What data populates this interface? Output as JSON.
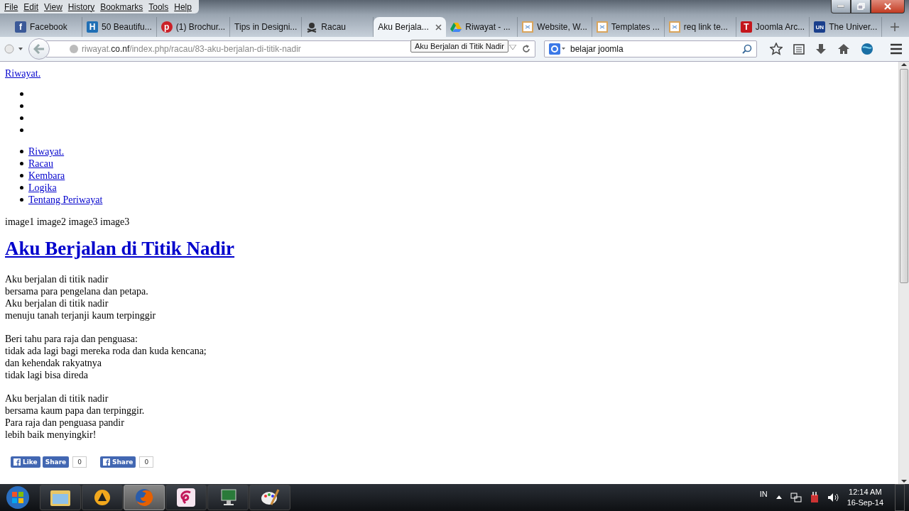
{
  "menu_bar": [
    "File",
    "Edit",
    "View",
    "History",
    "Bookmarks",
    "Tools",
    "Help"
  ],
  "tabs": [
    {
      "label": "Facebook",
      "selected": false,
      "favicon": {
        "kind": "letter",
        "text": "f",
        "color": "#3b5998"
      }
    },
    {
      "label": "50 Beautifu...",
      "selected": false,
      "favicon": {
        "kind": "letter",
        "text": "H",
        "color": "#1f6fb5"
      }
    },
    {
      "label": "(1) Brochur...",
      "selected": false,
      "favicon": {
        "kind": "round",
        "text": "p",
        "color": "#cb2027"
      }
    },
    {
      "label": "Tips in Designi...",
      "selected": false
    },
    {
      "label": "Racau",
      "selected": false,
      "favicon": {
        "kind": "skull"
      }
    },
    {
      "label": "Aku Berjala...",
      "selected": true
    },
    {
      "label": "Riwayat - ...",
      "selected": false,
      "favicon": {
        "kind": "drive"
      }
    },
    {
      "label": "Website, W...",
      "selected": false,
      "favicon": {
        "kind": "page"
      }
    },
    {
      "label": "Templates ...",
      "selected": false,
      "favicon": {
        "kind": "page"
      }
    },
    {
      "label": "req link te...",
      "selected": false,
      "favicon": {
        "kind": "page"
      }
    },
    {
      "label": "Joomla Arc...",
      "selected": false,
      "favicon": {
        "kind": "letter",
        "text": "T",
        "color": "#c4161c"
      }
    },
    {
      "label": "The Univer...",
      "selected": false,
      "favicon": {
        "kind": "letter",
        "text": "UN",
        "color": "#1a3f8c"
      }
    }
  ],
  "address_bar": {
    "host": "riwayat.",
    "domain": "co.nf",
    "path": "/index.php/racau/83-aku-berjalan-di-titik-nadir"
  },
  "tooltip": "Aku Berjalan di Titik Nadir",
  "search": {
    "value": "belajar joomla"
  },
  "page": {
    "site_link": "Riwayat.",
    "empty_menu": [
      {
        "kind": "bullet"
      },
      {
        "kind": "bullet"
      },
      {
        "kind": "bullet"
      },
      {
        "kind": "bullet"
      }
    ],
    "nav": [
      "Riwayat.",
      "Racau",
      "Kembara",
      "Logika",
      "Tentang Periwayat"
    ],
    "images_text": "image1 image2 image3 image3",
    "title": "Aku Berjalan di Titik Nadir",
    "stanzas": [
      [
        "Aku berjalan di titik nadir",
        "bersama para pengelana dan petapa.",
        "Aku berjalan di titik nadir",
        "menuju tanah terjanji kaum terpinggir"
      ],
      [
        "Beri tahu para raja dan penguasa:",
        "tidak ada lagi bagi mereka roda dan kuda kencana;",
        "dan kehendak rakyatnya",
        "tidak lagi bisa direda"
      ],
      [
        "Aku berjalan di titik nadir",
        "bersama kaum papa dan terpinggir.",
        "Para raja dan penguasa pandir",
        "lebih baik menyingkir!"
      ]
    ],
    "social": [
      {
        "kind": "like",
        "label": "Like"
      },
      {
        "kind": "share",
        "label": "Share",
        "count": "0"
      },
      {
        "kind": "fbshare",
        "label": "Share",
        "count": "0"
      }
    ]
  },
  "taskbar": {
    "apps": [
      {
        "kind": "explorer",
        "selected": false
      },
      {
        "kind": "player",
        "selected": false
      },
      {
        "kind": "firefox",
        "selected": true
      },
      {
        "kind": "pink",
        "selected": false
      },
      {
        "kind": "monitor",
        "selected": false
      },
      {
        "kind": "paint",
        "selected": false
      }
    ],
    "language": "IN",
    "time": "12:14 AM",
    "date": "16-Sep-14"
  }
}
